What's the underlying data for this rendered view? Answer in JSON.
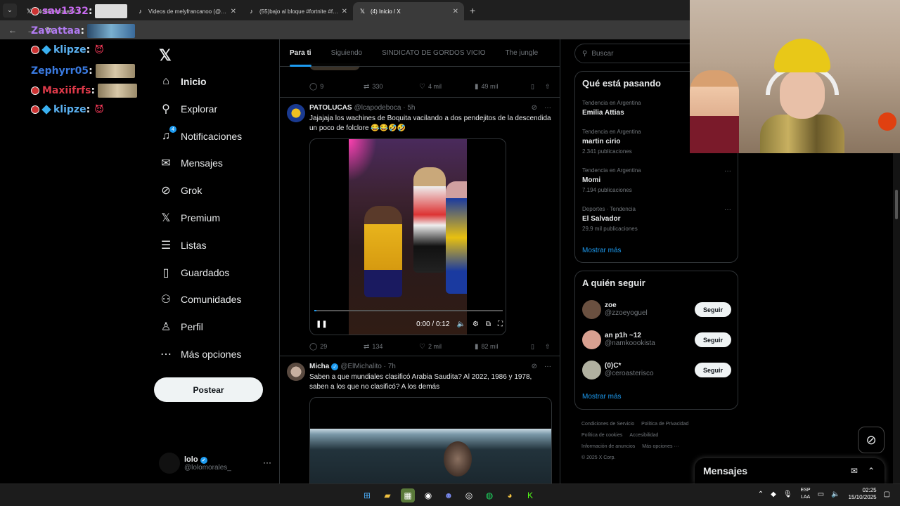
{
  "browser": {
    "tabs": [
      {
        "label": "Notificaciones / X",
        "icon": "x-logo-icon",
        "active": false
      },
      {
        "label": "Videos de melyfrancanoo (@m...",
        "icon": "tiktok-icon",
        "active": false
      },
      {
        "label": "(55)bajo al bloque #fortnite #fu...",
        "icon": "tiktok-icon",
        "active": false
      },
      {
        "label": "(4) Inicio / X",
        "icon": "x-logo-icon",
        "active": true
      }
    ]
  },
  "overlays": [
    {
      "user": "sav1332",
      "color": "#c86af0",
      "decor": "none"
    },
    {
      "user": "Zavattaa",
      "color": "#b07af0",
      "decor": "none"
    },
    {
      "user": "klipze",
      "color": "#5ab0f0",
      "decor": "cube"
    },
    {
      "user": "Zephyrr05",
      "color": "#3a7ae0",
      "decor": "none"
    },
    {
      "user": "Maxiifrfs",
      "color": "#e03a4a",
      "decor": "bullet"
    },
    {
      "user": "klipze",
      "color": "#5ab0f0",
      "decor": "cube"
    }
  ],
  "nav": {
    "items": [
      {
        "label": "Inicio",
        "icon": "home-icon",
        "active": true
      },
      {
        "label": "Explorar",
        "icon": "search-icon"
      },
      {
        "label": "Notificaciones",
        "icon": "bell-icon",
        "badge": "4"
      },
      {
        "label": "Mensajes",
        "icon": "mail-icon"
      },
      {
        "label": "Grok",
        "icon": "grok-icon"
      },
      {
        "label": "Premium",
        "icon": "x-premium-icon"
      },
      {
        "label": "Listas",
        "icon": "list-icon"
      },
      {
        "label": "Guardados",
        "icon": "bookmark-icon"
      },
      {
        "label": "Comunidades",
        "icon": "communities-icon"
      },
      {
        "label": "Perfil",
        "icon": "person-icon"
      },
      {
        "label": "Más opciones",
        "icon": "more-circle-icon"
      }
    ],
    "post_label": "Postear",
    "account": {
      "name": "lolo",
      "handle": "@lolomorales_"
    }
  },
  "feed": {
    "tabs": [
      "Para ti",
      "Siguiendo",
      "SINDICATO DE GORDOS VICIO",
      "The jungle"
    ],
    "prev_stats": {
      "replies": "9",
      "reposts": "330",
      "likes": "4 mil",
      "views": "49 mil"
    },
    "tweet1": {
      "name": "PATOLUCAS",
      "handle": "@lcapodeboca · 5h",
      "text": "Jajajaja los wachines de Boquita vacilando a dos pendejitos de la descendida un poco de folclore 😂😂🤣🤣",
      "video_time": "0:00 / 0:12",
      "video_progress": 0.01,
      "stats": {
        "replies": "29",
        "reposts": "134",
        "likes": "2 mil",
        "views": "82 mil"
      }
    },
    "tweet2": {
      "name": "Micha",
      "handle": "@ElMichalito · 7h",
      "text": "Saben a que mundiales clasificó Arabia Saudita? Al 2022, 1986 y 1978, saben a los que no clasificó? A los demás"
    }
  },
  "right": {
    "search_placeholder": "Buscar",
    "trends_title": "Qué está pasando",
    "trends": [
      {
        "meta": "Tendencia en Argentina",
        "title": "Emilia Attias",
        "count": ""
      },
      {
        "meta": "Tendencia en Argentina",
        "title": "martin cirio",
        "count": "2.341 publicaciones"
      },
      {
        "meta": "Tendencia en Argentina",
        "title": "Momi",
        "count": "7.194 publicaciones"
      },
      {
        "meta": "Deportes · Tendencia",
        "title": "El Salvador",
        "count": "29,9 mil publicaciones"
      }
    ],
    "show_more": "Mostrar más",
    "follow_title": "A quién seguir",
    "follow": [
      {
        "name": "zoe",
        "handle": "@zzoeyoguel",
        "color": "#6a5040"
      },
      {
        "name": "an p1h ~12",
        "handle": "@namkoookista",
        "color": "#d8a090"
      },
      {
        "name": "(0)C*",
        "handle": "@ceroasterisco",
        "color": "#b0b0a0"
      }
    ],
    "follow_btn": "Seguir",
    "footer": [
      "Condiciones de Servicio",
      "Política de Privacidad",
      "Política de cookies",
      "Accesibilidad",
      "Información de anuncios",
      "Más opciones ···",
      "© 2025 X Corp."
    ],
    "messages_title": "Mensajes"
  },
  "taskbar": {
    "lang1": "ESP",
    "lang2": "LAA",
    "time": "02:25",
    "date": "15/10/2025"
  }
}
